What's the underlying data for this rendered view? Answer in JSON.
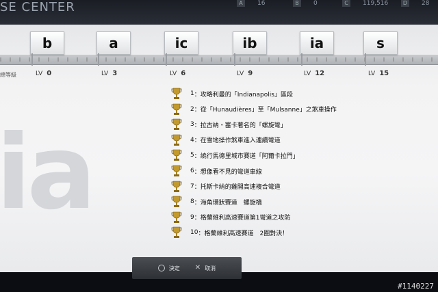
{
  "header": {
    "title": "SE CENTER",
    "stats": [
      {
        "key": "A",
        "value": "16"
      },
      {
        "key": "B",
        "value": "0"
      },
      {
        "key": "C",
        "value": "119,516"
      },
      {
        "key": "D",
        "value": "28"
      }
    ]
  },
  "rank_label": "總等級",
  "licenses": [
    {
      "badge": "b",
      "lv": "0"
    },
    {
      "badge": "a",
      "lv": "3"
    },
    {
      "badge": "ic",
      "lv": "6"
    },
    {
      "badge": "ib",
      "lv": "9"
    },
    {
      "badge": "ia",
      "lv": "12"
    },
    {
      "badge": "s",
      "lv": "15"
    }
  ],
  "lv_prefix": "LV",
  "watermark": "ia",
  "missions": [
    {
      "num": "1",
      "text": "攻略利曼的「Indianapolis」區段"
    },
    {
      "num": "2",
      "text": "從「Hunaudières」至「Mulsanne」之煞車操作"
    },
    {
      "num": "3",
      "text": "拉古納・塞卡著名的「螺旋彎」"
    },
    {
      "num": "4",
      "text": "在雪地操作煞車進入連續彎道"
    },
    {
      "num": "5",
      "text": "繞行馬德里城市賽道「阿爾卡拉門」"
    },
    {
      "num": "6",
      "text": "想像看不見的彎道車線"
    },
    {
      "num": "7",
      "text": "托斯卡納的雞開高速複合彎道"
    },
    {
      "num": "8",
      "text": "海角環狀賽道　螺旋橋"
    },
    {
      "num": "9",
      "text": "格蘭維利高速賽道第1彎道之攻防"
    },
    {
      "num": "10",
      "text": "格蘭維利高速賽道　2圈對決！"
    }
  ],
  "controls": {
    "confirm": "決定",
    "cancel": "取消"
  },
  "photo_id": "#1140227",
  "colors": {
    "trophy": "#b8902a",
    "screen": "#f3f3f4",
    "bar": "#2d3035"
  }
}
